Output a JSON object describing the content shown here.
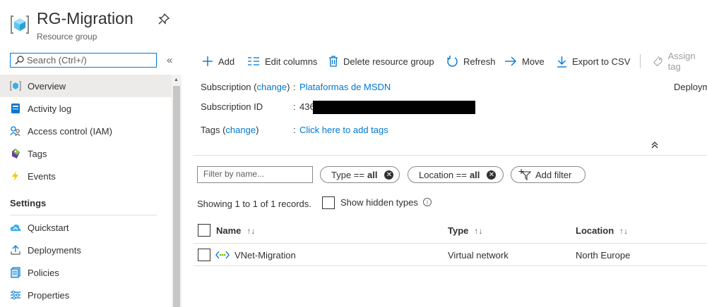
{
  "header": {
    "title": "RG-Migration",
    "subtitle": "Resource group"
  },
  "sidebar": {
    "search_placeholder": "Search (Ctrl+/)",
    "collapse": "«",
    "items": [
      {
        "label": "Overview",
        "icon": "overview-icon"
      },
      {
        "label": "Activity log",
        "icon": "activity-log-icon"
      },
      {
        "label": "Access control (IAM)",
        "icon": "iam-icon"
      },
      {
        "label": "Tags",
        "icon": "tag-icon"
      },
      {
        "label": "Events",
        "icon": "lightning-icon"
      }
    ],
    "section_settings": "Settings",
    "settings_items": [
      {
        "label": "Quickstart",
        "icon": "quickstart-icon"
      },
      {
        "label": "Deployments",
        "icon": "deployments-icon"
      },
      {
        "label": "Policies",
        "icon": "policies-icon"
      },
      {
        "label": "Properties",
        "icon": "properties-icon"
      }
    ]
  },
  "toolbar": {
    "add": "Add",
    "edit_columns": "Edit columns",
    "delete": "Delete resource group",
    "refresh": "Refresh",
    "move": "Move",
    "export": "Export to CSV",
    "assign_tags": "Assign tag"
  },
  "essentials": {
    "subscription_label": "Subscription (",
    "change": "change",
    "close_paren": ")",
    "colon": ":",
    "subscription_value": "Plataformas de MSDN",
    "subscription_id_label": "Subscription ID",
    "subscription_id_value": "436",
    "tags_label": "Tags (",
    "tags_value": "Click here to add tags",
    "deployments_label": "Deploym",
    "chevron": "˄˄"
  },
  "filters": {
    "name_placeholder": "Filter by name...",
    "type_label": "Type ==",
    "type_value": "all",
    "location_label": "Location ==",
    "location_value": "all",
    "add_filter": "Add filter"
  },
  "records": {
    "summary": "Showing 1 to 1 of 1 records.",
    "show_hidden": "Show hidden types"
  },
  "table": {
    "headers": [
      "Name",
      "Type",
      "Location"
    ],
    "sort_glyph": "↑↓",
    "rows": [
      {
        "name": "VNet-Migration",
        "type": "Virtual network",
        "location": "North Europe"
      }
    ]
  },
  "colors": {
    "accent": "#0078d4",
    "selected_bg": "#edebe9"
  }
}
